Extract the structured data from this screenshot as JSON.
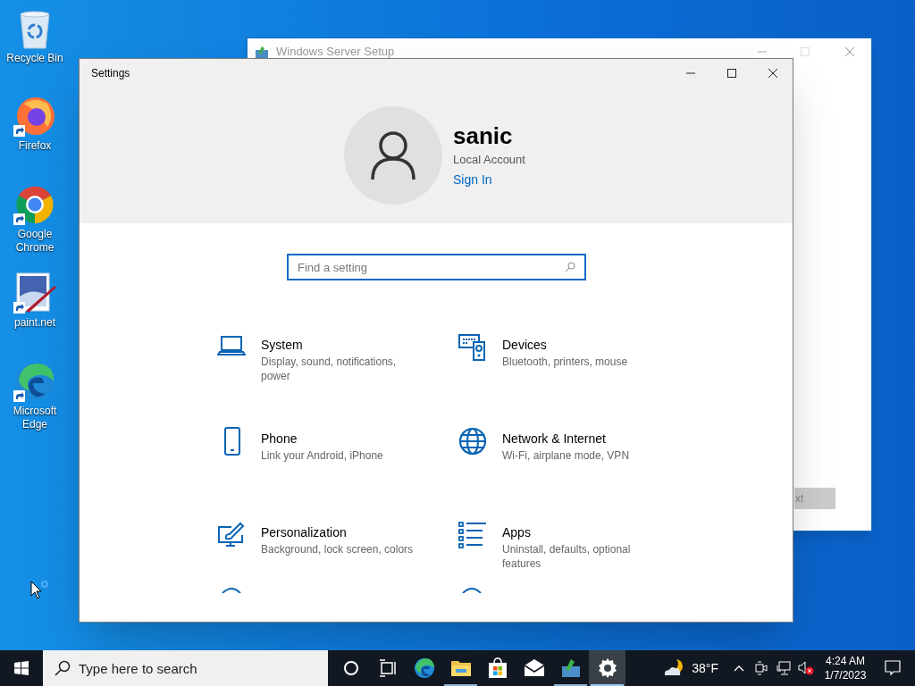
{
  "desktop_icons": [
    {
      "kind": "recycle",
      "label": "Recycle Bin"
    },
    {
      "kind": "firefox",
      "label": "Firefox"
    },
    {
      "kind": "chrome",
      "label": "Google Chrome"
    },
    {
      "kind": "paint",
      "label": "paint.net"
    },
    {
      "kind": "edge",
      "label": "Microsoft Edge"
    }
  ],
  "setup_window": {
    "title": "Windows Server Setup",
    "button": "xt"
  },
  "settings": {
    "title": "Settings",
    "user": {
      "name": "sanic",
      "account": "Local Account",
      "link": "Sign In"
    },
    "search": {
      "placeholder": "Find a setting"
    },
    "categories": [
      {
        "kind": "system",
        "title": "System",
        "subtitle": "Display, sound, notifications, power"
      },
      {
        "kind": "devices",
        "title": "Devices",
        "subtitle": "Bluetooth, printers, mouse"
      },
      {
        "kind": "phone",
        "title": "Phone",
        "subtitle": "Link your Android, iPhone"
      },
      {
        "kind": "network",
        "title": "Network & Internet",
        "subtitle": "Wi-Fi, airplane mode, VPN"
      },
      {
        "kind": "personalization",
        "title": "Personalization",
        "subtitle": "Background, lock screen, colors"
      },
      {
        "kind": "apps",
        "title": "Apps",
        "subtitle": "Uninstall, defaults, optional features"
      }
    ]
  },
  "taskbar": {
    "search": {
      "placeholder": "Type here to search"
    },
    "apps": [
      {
        "kind": "cortana",
        "selected": false,
        "running": false
      },
      {
        "kind": "taskview",
        "selected": false,
        "running": false
      },
      {
        "kind": "edge",
        "selected": false,
        "running": false
      },
      {
        "kind": "explorer",
        "selected": false,
        "running": true
      },
      {
        "kind": "store",
        "selected": false,
        "running": false
      },
      {
        "kind": "mail",
        "selected": false,
        "running": false
      },
      {
        "kind": "setup",
        "selected": false,
        "running": true
      },
      {
        "kind": "settings",
        "selected": true,
        "running": true
      }
    ],
    "temperature": "38°F",
    "time": "4:24 AM",
    "date": "1/7/2023"
  }
}
